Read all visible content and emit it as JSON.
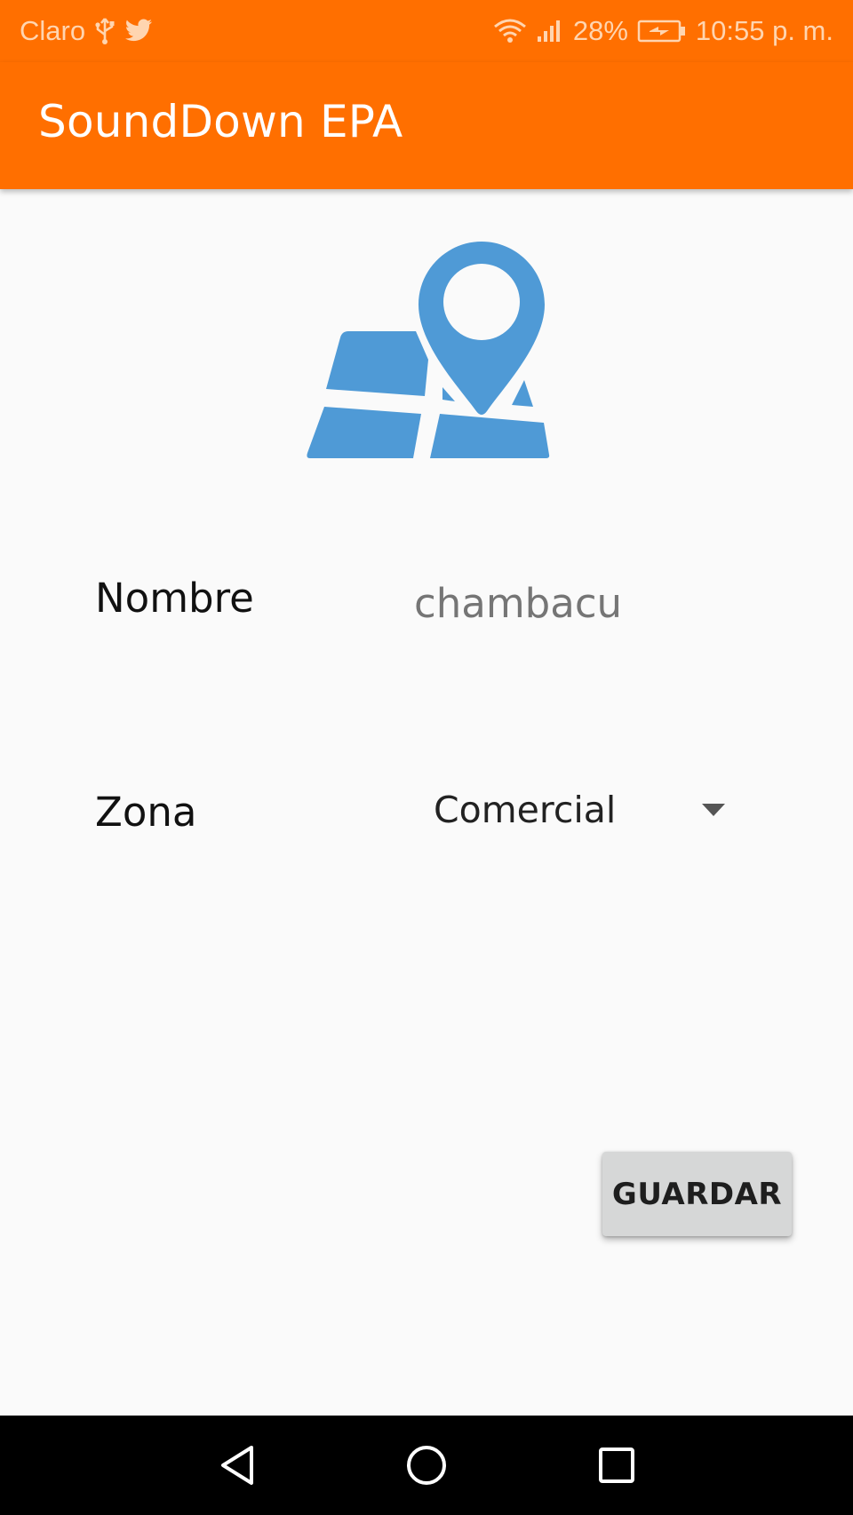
{
  "status_bar": {
    "carrier": "Claro",
    "battery_percent": "28%",
    "time": "10:55 p. m.",
    "icons": [
      "usb-icon",
      "twitter-icon",
      "wifi-icon",
      "signal-icon",
      "battery-charging-icon"
    ]
  },
  "app_bar": {
    "title": "SoundDown EPA"
  },
  "illustration": {
    "icon": "map-pin-icon",
    "color": "#4f9ad6"
  },
  "form": {
    "nombre_label": "Nombre",
    "nombre_value": "chambacu",
    "zona_label": "Zona",
    "zona_selected": "Comercial"
  },
  "actions": {
    "save_label": "GUARDAR"
  },
  "nav_bar": {
    "buttons": [
      "back-icon",
      "home-icon",
      "recents-icon"
    ]
  },
  "colors": {
    "primary": "#ff6f00",
    "background": "#fafafa",
    "button": "#d6d7d7"
  }
}
